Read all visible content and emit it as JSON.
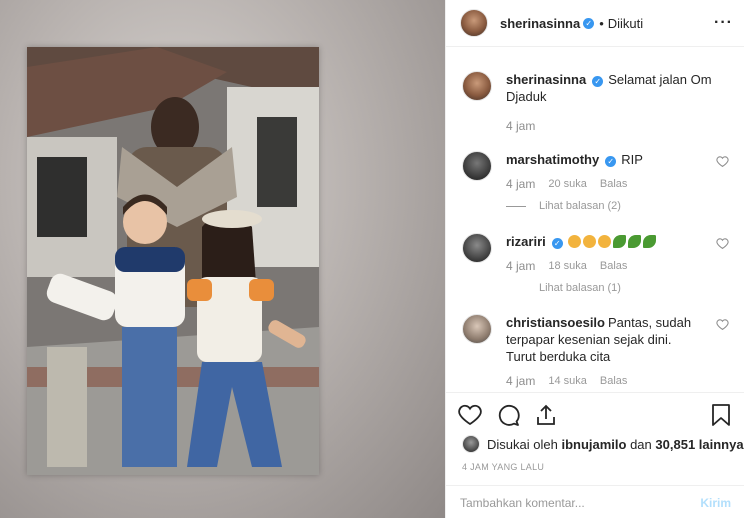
{
  "post": {
    "username": "sherinasinna",
    "follow_state": "Diikuti"
  },
  "caption": {
    "username": "sherinasinna",
    "text": "Selamat jalan Om Djaduk",
    "time": "4 jam"
  },
  "comments": [
    {
      "username": "marshatimothy",
      "text": "RIP",
      "time": "4 jam",
      "likes": "20 suka",
      "reply_label": "Balas",
      "view_replies": "Lihat balasan (2)"
    },
    {
      "username": "rizariri",
      "emojis": [
        "sad-face",
        "sad-face",
        "sad-face",
        "leaf",
        "leaf",
        "leaf"
      ],
      "time": "4 jam",
      "likes": "18 suka",
      "reply_label": "Balas",
      "view_replies": "Lihat balasan (1)"
    },
    {
      "username": "christiansoesilo",
      "text": "Pantas, sudah terpapar kesenian sejak dini. Turut berduka cita",
      "time": "4 jam",
      "likes": "14 suka",
      "reply_label": "Balas"
    }
  ],
  "likes": {
    "prefix": "Disukai oleh",
    "user": "ibnujamilo",
    "connector": "dan",
    "count": "30,851 lainnya"
  },
  "timestamp": "4 JAM YANG LALU",
  "add_comment": {
    "placeholder": "Tambahkan komentar...",
    "post_label": "Kirim"
  },
  "colors": {
    "verified": "#3897f0",
    "text": "#262626",
    "muted": "#8e8e8e",
    "post_button_disabled": "#b2dffc"
  }
}
